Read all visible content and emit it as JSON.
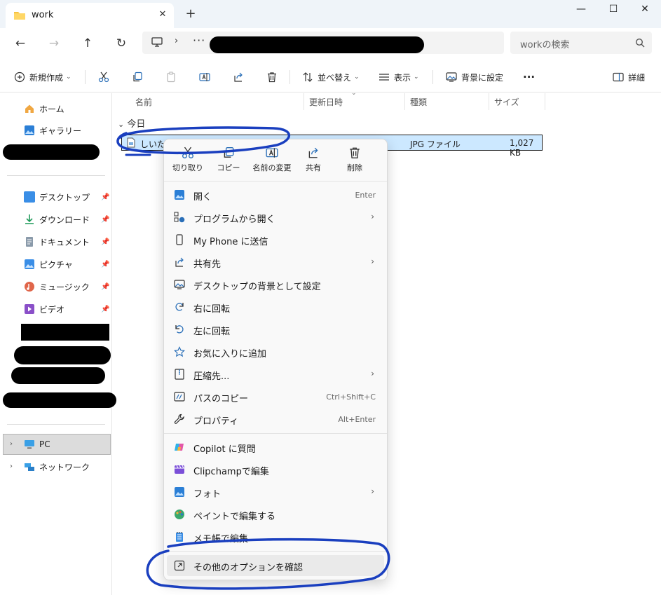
{
  "window": {
    "tab_title": "work",
    "tab_close": "✕",
    "new_tab": "+",
    "minimize": "—",
    "maximize": "☐",
    "close": "✕"
  },
  "address": {
    "more": "···",
    "chevron": "›",
    "search_placeholder": "workの検索"
  },
  "toolbar": {
    "new_label": "新規作成",
    "sort_label": "並べ替え",
    "view_label": "表示",
    "set_bg_label": "背景に設定",
    "more_label": "···",
    "details_label": "詳細"
  },
  "sidebar": {
    "home": "ホーム",
    "gallery": "ギャラリー",
    "quick_access": [
      {
        "label": "デスクトップ",
        "color": "#3a8ee6"
      },
      {
        "label": "ダウンロード",
        "color": "#1f9a5a"
      },
      {
        "label": "ドキュメント",
        "color": "#7a8a9a"
      },
      {
        "label": "ピクチャ",
        "color": "#3a8ee6"
      },
      {
        "label": "ミュージック",
        "color": "#e0664a"
      },
      {
        "label": "ビデオ",
        "color": "#8a4fc8"
      }
    ],
    "pc": "PC",
    "network": "ネットワーク"
  },
  "columns": {
    "name": "名前",
    "modified": "更新日時",
    "type": "種類",
    "size": "サイズ"
  },
  "group": {
    "label": "今日"
  },
  "file": {
    "name": "しいた",
    "type": "JPG ファイル",
    "size": "1,027 KB"
  },
  "context_menu": {
    "quick_actions": [
      {
        "label": "切り取り",
        "icon": "scissors-icon"
      },
      {
        "label": "コピー",
        "icon": "copy-icon"
      },
      {
        "label": "名前の変更",
        "icon": "rename-icon"
      },
      {
        "label": "共有",
        "icon": "share-icon"
      },
      {
        "label": "削除",
        "icon": "trash-icon"
      }
    ],
    "items": [
      {
        "label": "開く",
        "shortcut": "Enter",
        "icon": "photo-icon"
      },
      {
        "label": "プログラムから開く",
        "submenu": "›",
        "icon": "open-with-icon"
      },
      {
        "label": "My Phone に送信",
        "icon": "phone-icon"
      },
      {
        "label": "共有先",
        "submenu": "›",
        "icon": "share-icon"
      },
      {
        "label": "デスクトップの背景として設定",
        "icon": "wallpaper-icon"
      },
      {
        "label": "右に回転",
        "icon": "rotate-right-icon"
      },
      {
        "label": "左に回転",
        "icon": "rotate-left-icon"
      },
      {
        "label": "お気に入りに追加",
        "icon": "star-icon"
      },
      {
        "label": "圧縮先...",
        "submenu": "›",
        "icon": "zip-icon"
      },
      {
        "label": "パスのコピー",
        "shortcut": "Ctrl+Shift+C",
        "icon": "path-copy-icon"
      },
      {
        "label": "プロパティ",
        "shortcut": "Alt+Enter",
        "icon": "wrench-icon"
      }
    ],
    "apps": [
      {
        "label": "Copilot に質問",
        "icon": "copilot-icon"
      },
      {
        "label": "Clipchampで編集",
        "icon": "clipchamp-icon"
      },
      {
        "label": "フォト",
        "submenu": "›",
        "icon": "photos-icon"
      },
      {
        "label": "ペイントで編集する",
        "icon": "paint-icon"
      },
      {
        "label": "メモ帳で編集",
        "icon": "notepad-icon"
      }
    ],
    "more_options": {
      "label": "その他のオプションを確認",
      "icon": "more-options-icon"
    }
  },
  "colors": {
    "accent": "#0067c0",
    "selection": "#cce8ff",
    "annotation": "#1a3fbf"
  }
}
